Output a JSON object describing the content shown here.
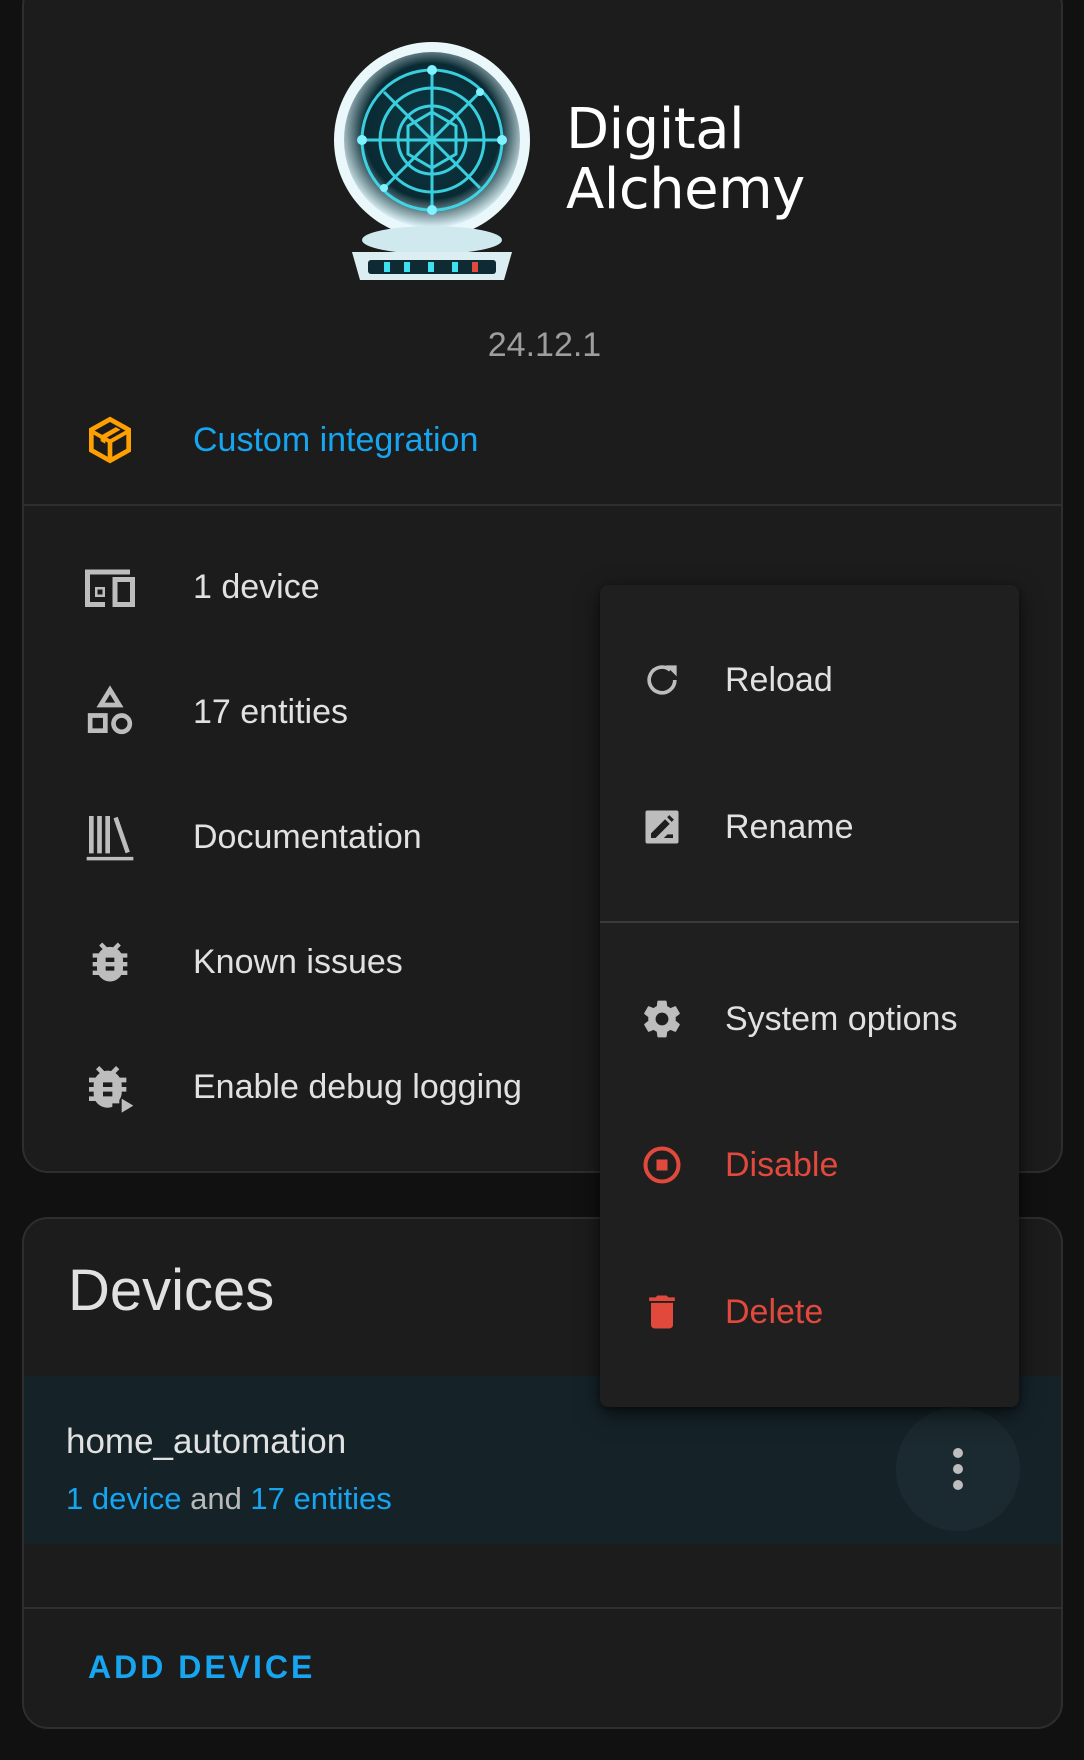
{
  "integration": {
    "logo_text_line1": "Digital",
    "logo_text_line2": "Alchemy",
    "version": "24.12.1",
    "custom_integration_label": "Custom integration"
  },
  "info_rows": [
    {
      "label": "1 device",
      "icon": "devices-icon"
    },
    {
      "label": "17 entities",
      "icon": "shapes-icon"
    },
    {
      "label": "Documentation",
      "icon": "bookshelf-icon"
    },
    {
      "label": "Known issues",
      "icon": "bug-icon"
    },
    {
      "label": "Enable debug logging",
      "icon": "bug-play-icon"
    }
  ],
  "devices_card": {
    "title": "Devices",
    "device": {
      "name": "home_automation",
      "devices_link": "1 device",
      "and_text": " and ",
      "entities_link": "17 entities"
    },
    "add_device_label": "ADD DEVICE"
  },
  "menu": {
    "items": [
      {
        "label": "Reload",
        "icon": "reload-icon"
      },
      {
        "label": "Rename",
        "icon": "rename-icon"
      },
      {
        "label": "System options",
        "icon": "gear-icon"
      },
      {
        "label": "Disable",
        "icon": "stop-circle-icon"
      },
      {
        "label": "Delete",
        "icon": "trash-icon"
      }
    ]
  },
  "colors": {
    "accent": "#16a6f1",
    "danger": "#e2493d",
    "custom_badge": "#ffa000",
    "background": "#111111",
    "card": "#1c1c1c"
  }
}
